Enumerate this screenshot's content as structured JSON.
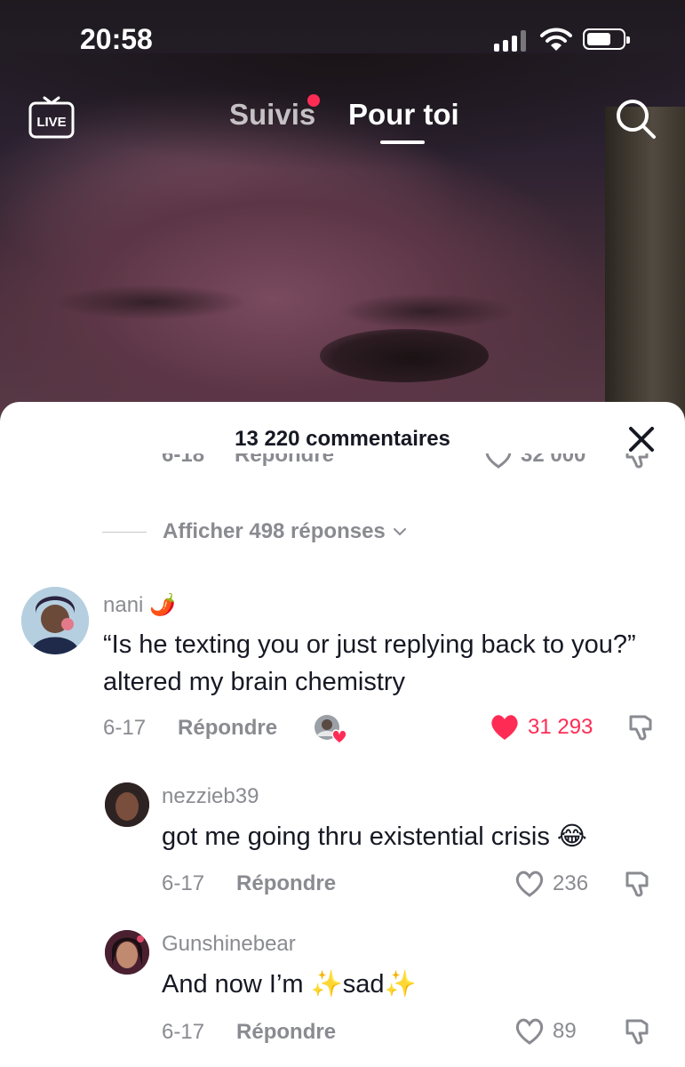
{
  "status_bar": {
    "time": "20:58"
  },
  "top_nav": {
    "live_label": "LIVE",
    "tabs": [
      {
        "label": "Suivis",
        "active": false,
        "has_notification": true
      },
      {
        "label": "Pour toi",
        "active": true
      }
    ]
  },
  "comments_sheet": {
    "title": "13 220 commentaires",
    "cutoff_row": {
      "date": "6-18",
      "reply_label": "Répondre",
      "likes": "32 000"
    },
    "show_more_replies": "Afficher 498 réponses",
    "comments": [
      {
        "username": "nani 🌶️",
        "text": "“Is he texting you or just replying back to you?” altered my brain chemistry",
        "date": "6-17",
        "reply_label": "Répondre",
        "likes": "31 293",
        "liked": true,
        "liked_by_creator": true
      },
      {
        "username": "nezzieb39",
        "text": "got me going thru existential crisis 😂",
        "date": "6-17",
        "reply_label": "Répondre",
        "likes": "236",
        "liked": false
      },
      {
        "username": "Gunshinebear",
        "text": "And now I’m ✨sad✨",
        "date": "6-17",
        "reply_label": "Répondre",
        "likes": "89",
        "liked": false
      }
    ]
  },
  "colors": {
    "accent": "#fe2c55",
    "muted_text": "#8a8b91",
    "primary_text": "#161823"
  },
  "icons": [
    "live-icon",
    "search-icon",
    "close-icon",
    "heart-icon",
    "dislike-icon",
    "chevron-down-icon"
  ]
}
